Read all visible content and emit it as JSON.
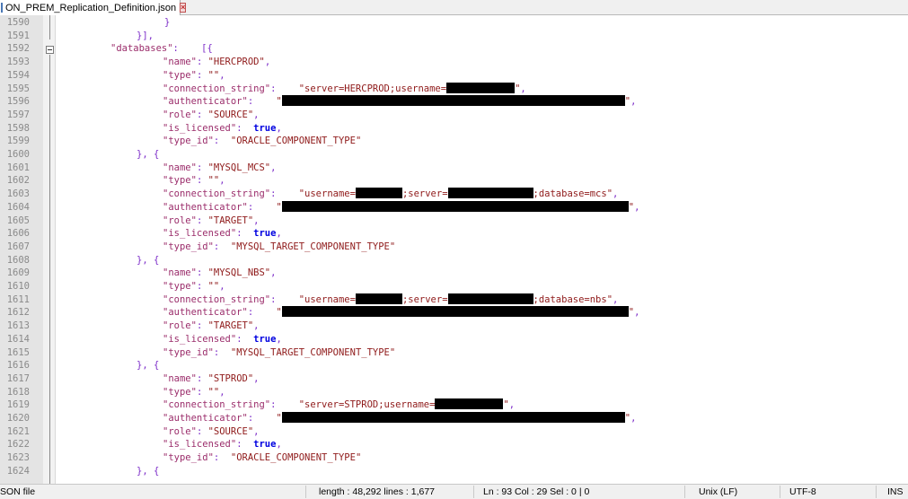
{
  "tab": {
    "filename": "ON_PREM_Replication_Definition.json",
    "icon": "file-icon",
    "close_icon": "close-icon"
  },
  "colors": {
    "key": "#9b2d6b",
    "string": "#8f1a1a",
    "punct": "#7d2ec9",
    "bool": "#0000e0",
    "redaction": "#000000"
  },
  "lines": [
    {
      "n": "1590",
      "parts": [
        {
          "t": "p",
          "v": "}"
        }
      ]
    },
    {
      "n": "1591",
      "parts": [
        {
          "t": "p",
          "v": "}],"
        }
      ]
    },
    {
      "n": "1592",
      "parts": [
        {
          "t": "k",
          "v": "\"databases\""
        },
        {
          "t": "p",
          "v": ":    [{"
        }
      ]
    },
    {
      "n": "1593",
      "parts": [
        {
          "t": "k",
          "v": "\"name\""
        },
        {
          "t": "p",
          "v": ": "
        },
        {
          "t": "s",
          "v": "\"HERCPROD\""
        },
        {
          "t": "p",
          "v": ","
        }
      ]
    },
    {
      "n": "1594",
      "parts": [
        {
          "t": "k",
          "v": "\"type\""
        },
        {
          "t": "p",
          "v": ": "
        },
        {
          "t": "s",
          "v": "\"\""
        },
        {
          "t": "p",
          "v": ","
        }
      ]
    },
    {
      "n": "1595",
      "parts": [
        {
          "t": "k",
          "v": "\"connection_string\""
        },
        {
          "t": "p",
          "v": ":    "
        },
        {
          "t": "s",
          "v": "\"server=HERCPROD;username="
        },
        {
          "t": "r",
          "w": 76
        },
        {
          "t": "s",
          "v": "\""
        },
        {
          "t": "p",
          "v": ","
        }
      ]
    },
    {
      "n": "1596",
      "parts": [
        {
          "t": "k",
          "v": "\"authenticator\""
        },
        {
          "t": "p",
          "v": ":    "
        },
        {
          "t": "s",
          "v": "\""
        },
        {
          "t": "r",
          "w": 382
        },
        {
          "t": "s",
          "v": "\""
        },
        {
          "t": "p",
          "v": ","
        }
      ]
    },
    {
      "n": "1597",
      "parts": [
        {
          "t": "k",
          "v": "\"role\""
        },
        {
          "t": "p",
          "v": ": "
        },
        {
          "t": "s",
          "v": "\"SOURCE\""
        },
        {
          "t": "p",
          "v": ","
        }
      ]
    },
    {
      "n": "1598",
      "parts": [
        {
          "t": "k",
          "v": "\"is_licensed\""
        },
        {
          "t": "p",
          "v": ":  "
        },
        {
          "t": "b",
          "v": "true"
        },
        {
          "t": "p",
          "v": ","
        }
      ]
    },
    {
      "n": "1599",
      "parts": [
        {
          "t": "k",
          "v": "\"type_id\""
        },
        {
          "t": "p",
          "v": ":  "
        },
        {
          "t": "s",
          "v": "\"ORACLE_COMPONENT_TYPE\""
        }
      ]
    },
    {
      "n": "1600",
      "parts": [
        {
          "t": "p",
          "v": "}, {"
        }
      ]
    },
    {
      "n": "1601",
      "parts": [
        {
          "t": "k",
          "v": "\"name\""
        },
        {
          "t": "p",
          "v": ": "
        },
        {
          "t": "s",
          "v": "\"MYSQL_MCS\""
        },
        {
          "t": "p",
          "v": ","
        }
      ]
    },
    {
      "n": "1602",
      "parts": [
        {
          "t": "k",
          "v": "\"type\""
        },
        {
          "t": "p",
          "v": ": "
        },
        {
          "t": "s",
          "v": "\"\""
        },
        {
          "t": "p",
          "v": ","
        }
      ]
    },
    {
      "n": "1603",
      "parts": [
        {
          "t": "k",
          "v": "\"connection_string\""
        },
        {
          "t": "p",
          "v": ":    "
        },
        {
          "t": "s",
          "v": "\"username="
        },
        {
          "t": "r",
          "w": 52
        },
        {
          "t": "s",
          "v": ";server="
        },
        {
          "t": "r",
          "w": 95
        },
        {
          "t": "s",
          "v": ";database=mcs\""
        },
        {
          "t": "p",
          "v": ","
        }
      ]
    },
    {
      "n": "1604",
      "parts": [
        {
          "t": "k",
          "v": "\"authenticator\""
        },
        {
          "t": "p",
          "v": ":    "
        },
        {
          "t": "s",
          "v": "\""
        },
        {
          "t": "r",
          "w": 386
        },
        {
          "t": "s",
          "v": "\""
        },
        {
          "t": "p",
          "v": ","
        }
      ]
    },
    {
      "n": "1605",
      "parts": [
        {
          "t": "k",
          "v": "\"role\""
        },
        {
          "t": "p",
          "v": ": "
        },
        {
          "t": "s",
          "v": "\"TARGET\""
        },
        {
          "t": "p",
          "v": ","
        }
      ]
    },
    {
      "n": "1606",
      "parts": [
        {
          "t": "k",
          "v": "\"is_licensed\""
        },
        {
          "t": "p",
          "v": ":  "
        },
        {
          "t": "b",
          "v": "true"
        },
        {
          "t": "p",
          "v": ","
        }
      ]
    },
    {
      "n": "1607",
      "parts": [
        {
          "t": "k",
          "v": "\"type_id\""
        },
        {
          "t": "p",
          "v": ":  "
        },
        {
          "t": "s",
          "v": "\"MYSQL_TARGET_COMPONENT_TYPE\""
        }
      ]
    },
    {
      "n": "1608",
      "parts": [
        {
          "t": "p",
          "v": "}, {"
        }
      ]
    },
    {
      "n": "1609",
      "parts": [
        {
          "t": "k",
          "v": "\"name\""
        },
        {
          "t": "p",
          "v": ": "
        },
        {
          "t": "s",
          "v": "\"MYSQL_NBS\""
        },
        {
          "t": "p",
          "v": ","
        }
      ]
    },
    {
      "n": "1610",
      "parts": [
        {
          "t": "k",
          "v": "\"type\""
        },
        {
          "t": "p",
          "v": ": "
        },
        {
          "t": "s",
          "v": "\"\""
        },
        {
          "t": "p",
          "v": ","
        }
      ]
    },
    {
      "n": "1611",
      "parts": [
        {
          "t": "k",
          "v": "\"connection_string\""
        },
        {
          "t": "p",
          "v": ":    "
        },
        {
          "t": "s",
          "v": "\"username="
        },
        {
          "t": "r",
          "w": 52
        },
        {
          "t": "s",
          "v": ";server="
        },
        {
          "t": "r",
          "w": 95
        },
        {
          "t": "s",
          "v": ";database=nbs\""
        },
        {
          "t": "p",
          "v": ","
        }
      ]
    },
    {
      "n": "1612",
      "parts": [
        {
          "t": "k",
          "v": "\"authenticator\""
        },
        {
          "t": "p",
          "v": ":    "
        },
        {
          "t": "s",
          "v": "\""
        },
        {
          "t": "r",
          "w": 386
        },
        {
          "t": "s",
          "v": "\""
        },
        {
          "t": "p",
          "v": ","
        }
      ]
    },
    {
      "n": "1613",
      "parts": [
        {
          "t": "k",
          "v": "\"role\""
        },
        {
          "t": "p",
          "v": ": "
        },
        {
          "t": "s",
          "v": "\"TARGET\""
        },
        {
          "t": "p",
          "v": ","
        }
      ]
    },
    {
      "n": "1614",
      "parts": [
        {
          "t": "k",
          "v": "\"is_licensed\""
        },
        {
          "t": "p",
          "v": ":  "
        },
        {
          "t": "b",
          "v": "true"
        },
        {
          "t": "p",
          "v": ","
        }
      ]
    },
    {
      "n": "1615",
      "parts": [
        {
          "t": "k",
          "v": "\"type_id\""
        },
        {
          "t": "p",
          "v": ":  "
        },
        {
          "t": "s",
          "v": "\"MYSQL_TARGET_COMPONENT_TYPE\""
        }
      ]
    },
    {
      "n": "1616",
      "parts": [
        {
          "t": "p",
          "v": "}, {"
        }
      ]
    },
    {
      "n": "1617",
      "parts": [
        {
          "t": "k",
          "v": "\"name\""
        },
        {
          "t": "p",
          "v": ": "
        },
        {
          "t": "s",
          "v": "\"STPROD\""
        },
        {
          "t": "p",
          "v": ","
        }
      ]
    },
    {
      "n": "1618",
      "parts": [
        {
          "t": "k",
          "v": "\"type\""
        },
        {
          "t": "p",
          "v": ": "
        },
        {
          "t": "s",
          "v": "\"\""
        },
        {
          "t": "p",
          "v": ","
        }
      ]
    },
    {
      "n": "1619",
      "parts": [
        {
          "t": "k",
          "v": "\"connection_string\""
        },
        {
          "t": "p",
          "v": ":    "
        },
        {
          "t": "s",
          "v": "\"server=STPROD;username="
        },
        {
          "t": "r",
          "w": 76
        },
        {
          "t": "s",
          "v": "\""
        },
        {
          "t": "p",
          "v": ","
        }
      ]
    },
    {
      "n": "1620",
      "parts": [
        {
          "t": "k",
          "v": "\"authenticator\""
        },
        {
          "t": "p",
          "v": ":    "
        },
        {
          "t": "s",
          "v": "\""
        },
        {
          "t": "r",
          "w": 382
        },
        {
          "t": "s",
          "v": "\""
        },
        {
          "t": "p",
          "v": ","
        }
      ]
    },
    {
      "n": "1621",
      "parts": [
        {
          "t": "k",
          "v": "\"role\""
        },
        {
          "t": "p",
          "v": ": "
        },
        {
          "t": "s",
          "v": "\"SOURCE\""
        },
        {
          "t": "p",
          "v": ","
        }
      ]
    },
    {
      "n": "1622",
      "parts": [
        {
          "t": "k",
          "v": "\"is_licensed\""
        },
        {
          "t": "p",
          "v": ":  "
        },
        {
          "t": "b",
          "v": "true"
        },
        {
          "t": "p",
          "v": ","
        }
      ]
    },
    {
      "n": "1623",
      "parts": [
        {
          "t": "k",
          "v": "\"type_id\""
        },
        {
          "t": "p",
          "v": ":  "
        },
        {
          "t": "s",
          "v": "\"ORACLE_COMPONENT_TYPE\""
        }
      ]
    },
    {
      "n": "1624",
      "parts": [
        {
          "t": "p",
          "v": "}, {"
        }
      ]
    }
  ],
  "status": {
    "file_type": "SON file",
    "length_lines": "length : 48,292    lines : 1,677",
    "position": "Ln : 93    Col : 29    Sel : 0 | 0",
    "eol": "Unix (LF)",
    "encoding": "UTF-8",
    "mode": "INS"
  }
}
